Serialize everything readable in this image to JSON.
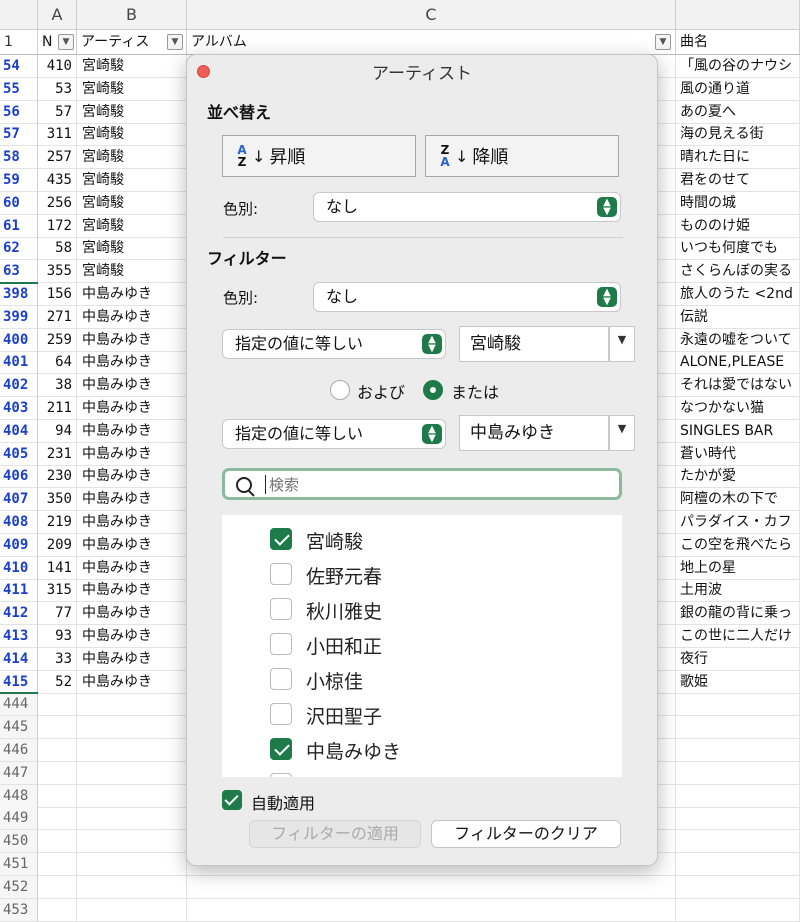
{
  "sheet": {
    "col_heads": [
      "A",
      "B",
      "C"
    ],
    "header_row": {
      "row_num": "1",
      "a": "N",
      "b": "アーティス",
      "c": "アルバム",
      "d": "曲名"
    },
    "rows": [
      {
        "n": "54",
        "a": "410",
        "b": "宮崎駿",
        "d": "「風の谷のナウシ"
      },
      {
        "n": "55",
        "a": "53",
        "b": "宮崎駿",
        "d": "風の通り道"
      },
      {
        "n": "56",
        "a": "57",
        "b": "宮崎駿",
        "d": "あの夏へ"
      },
      {
        "n": "57",
        "a": "311",
        "b": "宮崎駿",
        "d": "海の見える街"
      },
      {
        "n": "58",
        "a": "257",
        "b": "宮崎駿",
        "d": "晴れた日に"
      },
      {
        "n": "59",
        "a": "435",
        "b": "宮崎駿",
        "d": "君をのせて"
      },
      {
        "n": "60",
        "a": "256",
        "b": "宮崎駿",
        "d": "時間の城"
      },
      {
        "n": "61",
        "a": "172",
        "b": "宮崎駿",
        "d": "もののけ姫"
      },
      {
        "n": "62",
        "a": "58",
        "b": "宮崎駿",
        "d": "いつも何度でも"
      },
      {
        "n": "63",
        "a": "355",
        "b": "宮崎駿",
        "d": "さくらんぼの実る"
      },
      {
        "n": "398",
        "a": "156",
        "b": "中島みゆき",
        "d": "旅人のうた <2nd"
      },
      {
        "n": "399",
        "a": "271",
        "b": "中島みゆき",
        "d": "伝説"
      },
      {
        "n": "400",
        "a": "259",
        "b": "中島みゆき",
        "d": "永遠の嘘をついて"
      },
      {
        "n": "401",
        "a": "64",
        "b": "中島みゆき",
        "d": "ALONE,PLEASE"
      },
      {
        "n": "402",
        "a": "38",
        "b": "中島みゆき",
        "d": "それは愛ではない"
      },
      {
        "n": "403",
        "a": "211",
        "b": "中島みゆき",
        "d": "なつかない猫"
      },
      {
        "n": "404",
        "a": "94",
        "b": "中島みゆき",
        "d": "SINGLES BAR"
      },
      {
        "n": "405",
        "a": "231",
        "b": "中島みゆき",
        "d": "蒼い時代"
      },
      {
        "n": "406",
        "a": "230",
        "b": "中島みゆき",
        "d": "たかが愛"
      },
      {
        "n": "407",
        "a": "350",
        "b": "中島みゆき",
        "d": "阿檀の木の下で"
      },
      {
        "n": "408",
        "a": "219",
        "b": "中島みゆき",
        "d": "パラダイス・カフ"
      },
      {
        "n": "409",
        "a": "209",
        "b": "中島みゆき",
        "d": "この空を飛べたら"
      },
      {
        "n": "410",
        "a": "141",
        "b": "中島みゆき",
        "d": "地上の星"
      },
      {
        "n": "411",
        "a": "315",
        "b": "中島みゆき",
        "d": "土用波"
      },
      {
        "n": "412",
        "a": "77",
        "b": "中島みゆき",
        "d": "銀の龍の背に乗っ"
      },
      {
        "n": "413",
        "a": "93",
        "b": "中島みゆき",
        "d": "この世に二人だけ"
      },
      {
        "n": "414",
        "a": "33",
        "b": "中島みゆき",
        "d": "夜行"
      },
      {
        "n": "415",
        "a": "52",
        "b": "中島みゆき",
        "d": "歌姫"
      }
    ],
    "empty_rows": [
      "444",
      "445",
      "446",
      "447",
      "448",
      "449",
      "450",
      "451",
      "452",
      "453"
    ]
  },
  "dialog": {
    "title": "アーティスト",
    "sort": {
      "heading": "並べ替え",
      "asc_label": "昇順",
      "desc_label": "降順",
      "color_label": "色別:",
      "color_value": "なし"
    },
    "filter": {
      "heading": "フィルター",
      "color_label": "色別:",
      "color_value": "なし",
      "cond1_op": "指定の値に等しい",
      "cond1_value": "宮崎駿",
      "and_label": "および",
      "or_label": "または",
      "cond2_op": "指定の値に等しい",
      "cond2_value": "中島みゆき",
      "search_placeholder": "検索",
      "items": [
        {
          "label": "宮崎駿",
          "checked": true
        },
        {
          "label": "佐野元春",
          "checked": false
        },
        {
          "label": "秋川雅史",
          "checked": false
        },
        {
          "label": "小田和正",
          "checked": false
        },
        {
          "label": "小椋佳",
          "checked": false
        },
        {
          "label": "沢田聖子",
          "checked": false
        },
        {
          "label": "中島みゆき",
          "checked": true
        }
      ]
    },
    "auto_apply_label": "自動適用",
    "apply_button": "フィルターの適用",
    "clear_button": "フィルターのクリア"
  },
  "colors": {
    "accent": "#1f7a4a",
    "row_number_blue": "#1a3fcf",
    "close_dot": "#ee5e56"
  }
}
